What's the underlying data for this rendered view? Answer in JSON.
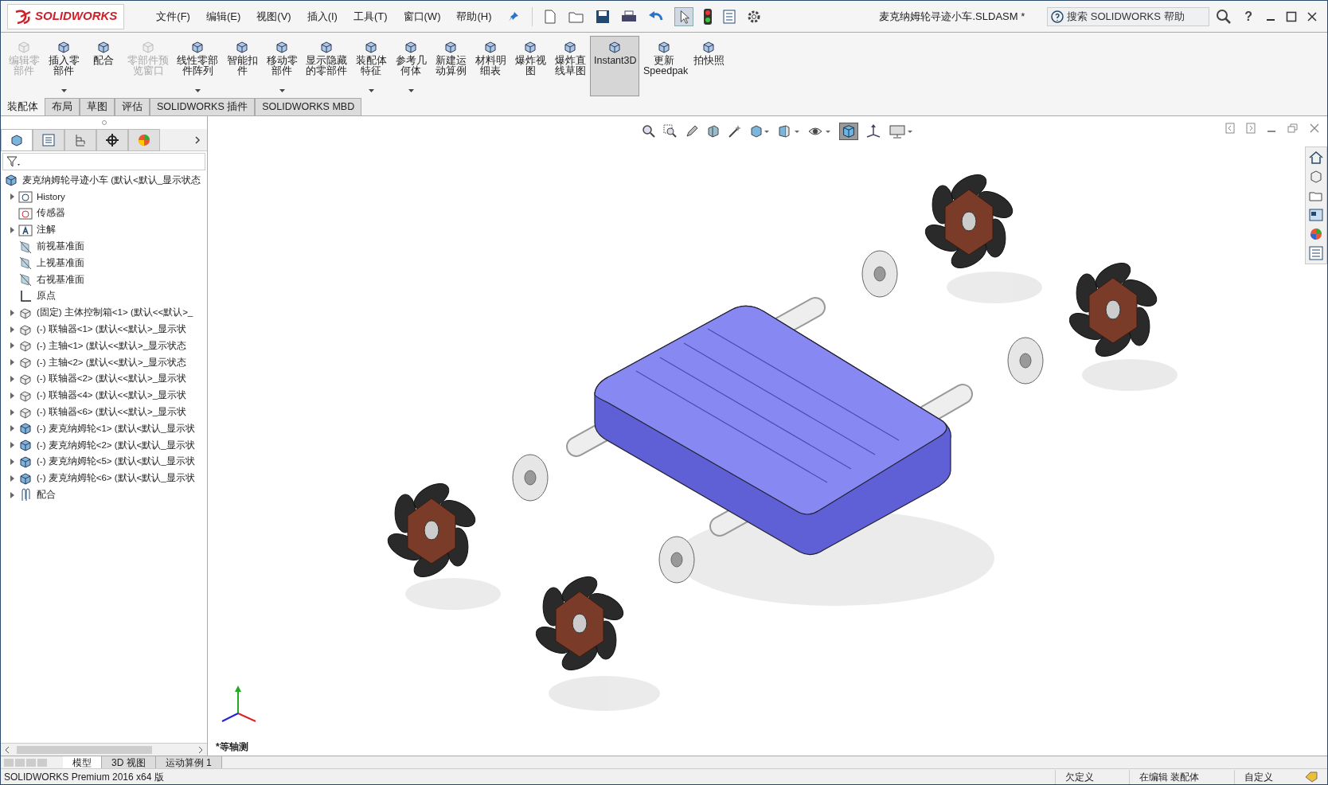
{
  "app": {
    "logo": "SOLIDWORKS",
    "title": "麦克纳姆轮寻迹小车.SLDASM *",
    "help_search": {
      "placeholder": "搜索 SOLIDWORKS 帮助"
    },
    "help_button": "?"
  },
  "menu": [
    "文件(F)",
    "编辑(E)",
    "视图(V)",
    "插入(I)",
    "工具(T)",
    "窗口(W)",
    "帮助(H)"
  ],
  "ribbon": [
    {
      "label": "编辑零部件",
      "disabled": true,
      "dropdown": false,
      "selected": false
    },
    {
      "label": "插入零部件",
      "disabled": false,
      "dropdown": true,
      "selected": false
    },
    {
      "label": "配合",
      "disabled": false,
      "dropdown": false,
      "selected": false
    },
    {
      "label": "零部件预览窗口",
      "disabled": true,
      "dropdown": false,
      "selected": false
    },
    {
      "label": "线性零部件阵列",
      "disabled": false,
      "dropdown": true,
      "selected": false
    },
    {
      "label": "智能扣件",
      "disabled": false,
      "dropdown": false,
      "selected": false
    },
    {
      "label": "移动零部件",
      "disabled": false,
      "dropdown": true,
      "selected": false
    },
    {
      "label": "显示隐藏的零部件",
      "disabled": false,
      "dropdown": false,
      "selected": false
    },
    {
      "label": "装配体特征",
      "disabled": false,
      "dropdown": true,
      "selected": false
    },
    {
      "label": "参考几何体",
      "disabled": false,
      "dropdown": true,
      "selected": false
    },
    {
      "label": "新建运动算例",
      "disabled": false,
      "dropdown": false,
      "selected": false
    },
    {
      "label": "材料明细表",
      "disabled": false,
      "dropdown": false,
      "selected": false
    },
    {
      "label": "爆炸视图",
      "disabled": false,
      "dropdown": false,
      "selected": false
    },
    {
      "label": "爆炸直线草图",
      "disabled": false,
      "dropdown": false,
      "selected": false
    },
    {
      "label": "Instant3D",
      "disabled": false,
      "dropdown": false,
      "selected": true
    },
    {
      "label": "更新 Speedpak",
      "disabled": false,
      "dropdown": false,
      "selected": false
    },
    {
      "label": "拍快照",
      "disabled": false,
      "dropdown": false,
      "selected": false
    }
  ],
  "tabs": [
    {
      "label": "装配体",
      "selected": true
    },
    {
      "label": "布局",
      "selected": false
    },
    {
      "label": "草图",
      "selected": false
    },
    {
      "label": "评估",
      "selected": false
    },
    {
      "label": "SOLIDWORKS 插件",
      "selected": false
    },
    {
      "label": "SOLIDWORKS MBD",
      "selected": false
    }
  ],
  "tree": {
    "label": "麦克纳姆轮寻迹小车  (默认<默认_显示状态",
    "kind": "assembly",
    "children": [
      {
        "label": "History",
        "kind": "history",
        "expandable": true
      },
      {
        "label": "传感器",
        "kind": "sensor",
        "expandable": false
      },
      {
        "label": "注解",
        "kind": "annotation",
        "expandable": true
      },
      {
        "label": "前视基准面",
        "kind": "plane",
        "expandable": false
      },
      {
        "label": "上视基准面",
        "kind": "plane",
        "expandable": false
      },
      {
        "label": "右视基准面",
        "kind": "plane",
        "expandable": false
      },
      {
        "label": "原点",
        "kind": "origin",
        "expandable": false
      },
      {
        "label": "(固定) 主体控制箱<1> (默认<<默认>_",
        "kind": "part",
        "expandable": true
      },
      {
        "label": "(-) 联轴器<1> (默认<<默认>_显示状",
        "kind": "part",
        "expandable": true
      },
      {
        "label": "(-) 主轴<1> (默认<<默认>_显示状态",
        "kind": "part",
        "expandable": true
      },
      {
        "label": "(-) 主轴<2> (默认<<默认>_显示状态",
        "kind": "part",
        "expandable": true
      },
      {
        "label": "(-) 联轴器<2> (默认<<默认>_显示状",
        "kind": "part",
        "expandable": true
      },
      {
        "label": "(-) 联轴器<4> (默认<<默认>_显示状",
        "kind": "part",
        "expandable": true
      },
      {
        "label": "(-) 联轴器<6> (默认<<默认>_显示状",
        "kind": "part",
        "expandable": true
      },
      {
        "label": "(-) 麦克纳姆轮<1> (默认<默认_显示状",
        "kind": "assembly",
        "expandable": true
      },
      {
        "label": "(-) 麦克纳姆轮<2> (默认<默认_显示状",
        "kind": "assembly",
        "expandable": true
      },
      {
        "label": "(-) 麦克纳姆轮<5> (默认<默认_显示状",
        "kind": "assembly",
        "expandable": true
      },
      {
        "label": "(-) 麦克纳姆轮<6> (默认<默认_显示状",
        "kind": "assembly",
        "expandable": true
      },
      {
        "label": "配合",
        "kind": "mates",
        "expandable": true
      }
    ]
  },
  "view_name": "*等轴测",
  "bottom_tabs": [
    {
      "label": "模型",
      "selected": true
    },
    {
      "label": "3D 视图",
      "selected": false
    },
    {
      "label": "运动算例 1",
      "selected": false
    }
  ],
  "status": {
    "product": "SOLIDWORKS Premium 2016 x64 版",
    "items": [
      "欠定义",
      "在编辑 装配体",
      "自定义"
    ]
  }
}
